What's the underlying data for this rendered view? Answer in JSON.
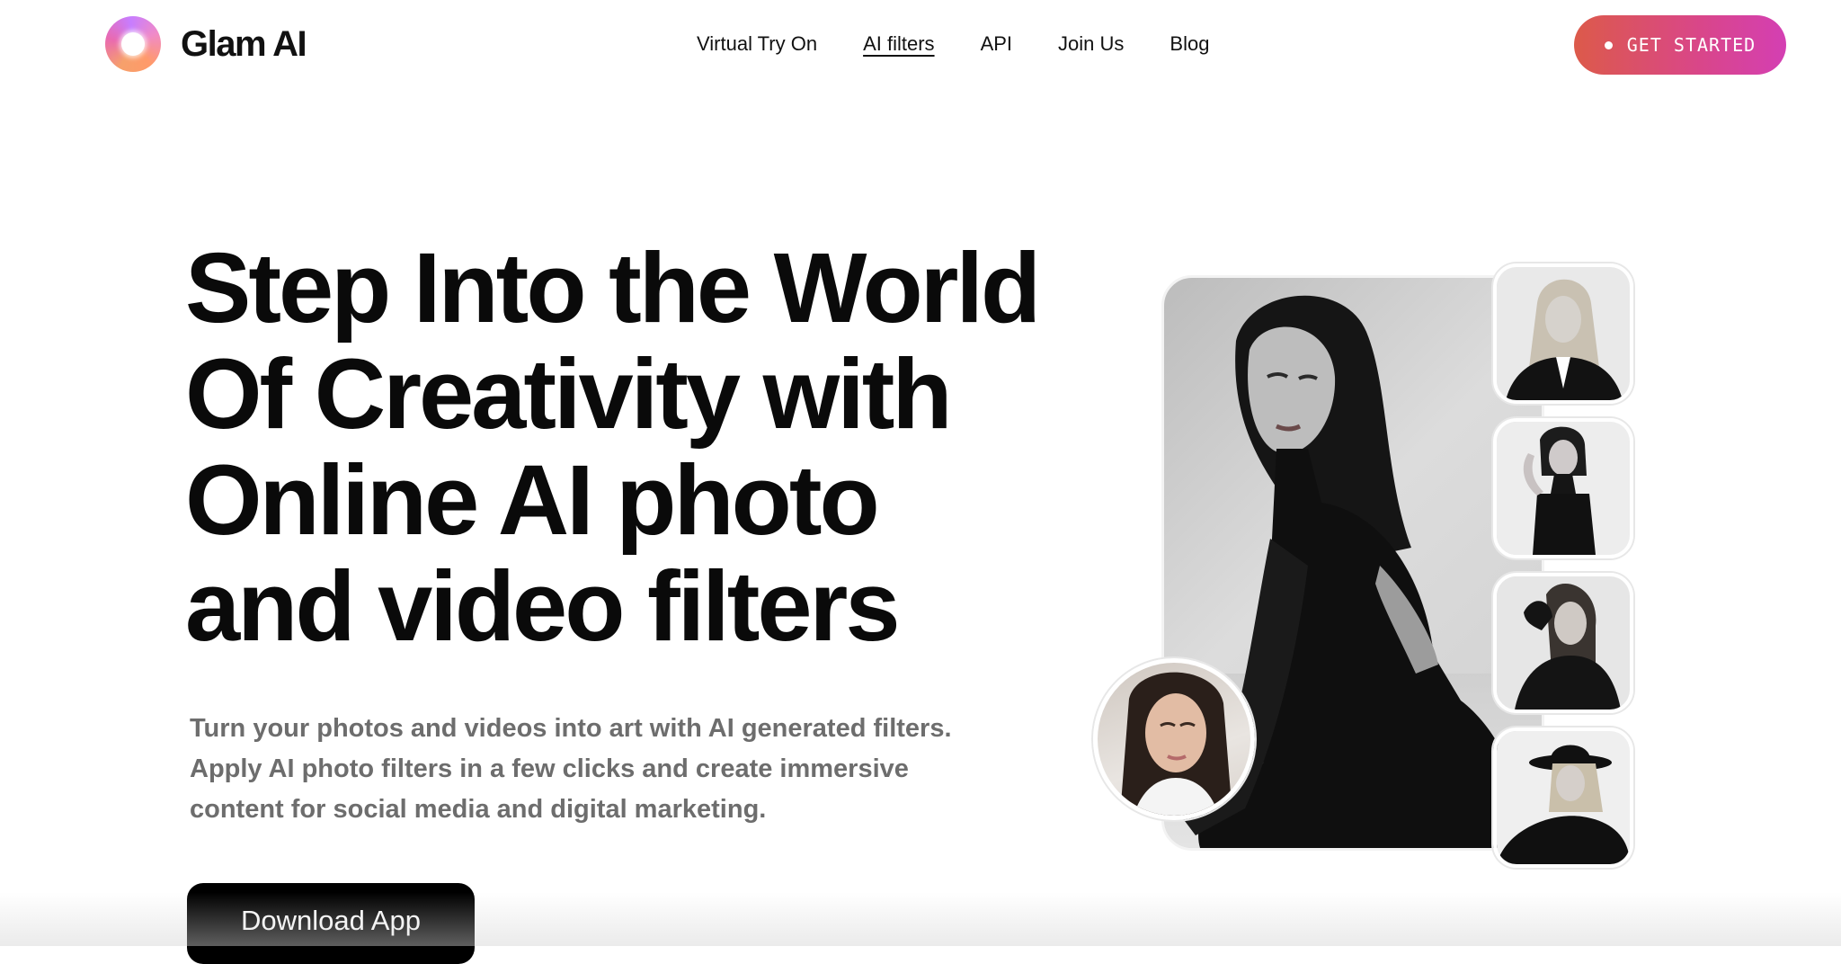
{
  "header": {
    "brand": "Glam AI",
    "nav": [
      {
        "label": "Virtual Try On"
      },
      {
        "label": "AI filters",
        "active": true
      },
      {
        "label": "API"
      },
      {
        "label": "Join Us"
      },
      {
        "label": "Blog"
      }
    ],
    "cta_label": "GET STARTED"
  },
  "hero": {
    "headline": "Step Into the World Of Creativity with Online AI photo and video filters",
    "subtext": "Turn your photos and videos into art with AI generated filters. Apply AI photo filters in a few clicks and create immersive content for social media and digital marketing.",
    "download_label": "Download App"
  },
  "colors": {
    "cta_gradient_start": "#dc5a4a",
    "cta_gradient_end": "#d43fb3",
    "headline": "#0a0a0a",
    "subtext": "#6d6d6d",
    "download_button": "#000000"
  }
}
